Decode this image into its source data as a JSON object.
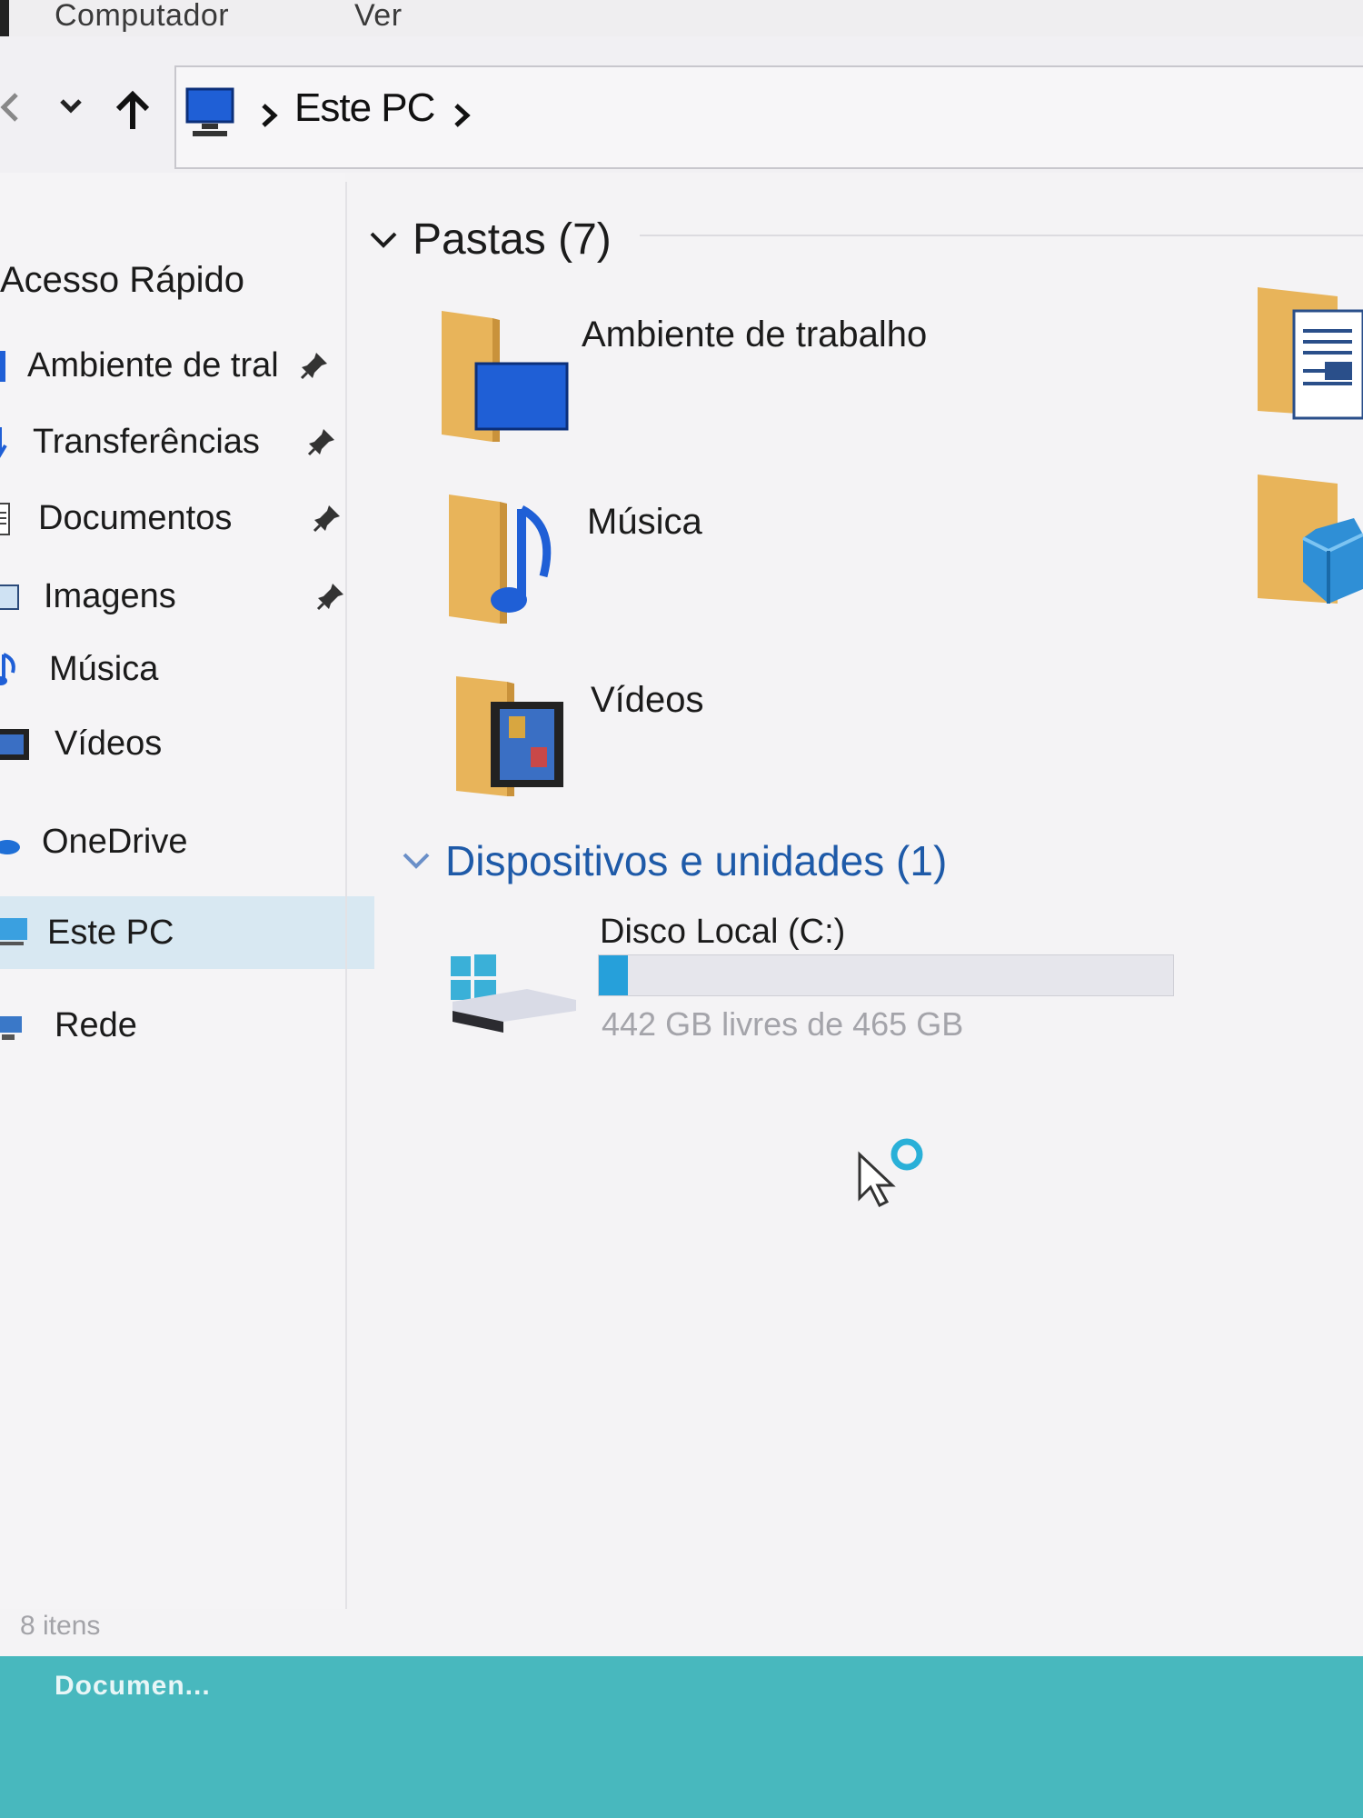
{
  "ribbon": {
    "tab_computer": "Computador",
    "tab_view": "Ver"
  },
  "address": {
    "breadcrumb_root": "Este PC",
    "icons": [
      "back-icon",
      "chevron-down-icon",
      "up-arrow-icon",
      "computer-icon",
      "chevron-right-icon"
    ]
  },
  "sidebar": {
    "quick_access": "Acesso Rápido",
    "items": [
      {
        "label": "Ambiente de tral",
        "icon": "desktop-icon",
        "pinned": true
      },
      {
        "label": "Transferências",
        "icon": "download-icon",
        "pinned": true
      },
      {
        "label": "Documentos",
        "icon": "documents-icon",
        "pinned": true
      },
      {
        "label": "Imagens",
        "icon": "pictures-icon",
        "pinned": true
      },
      {
        "label": "Música",
        "icon": "music-icon",
        "pinned": false
      },
      {
        "label": "Vídeos",
        "icon": "videos-icon",
        "pinned": false
      }
    ],
    "onedrive": "OneDrive",
    "this_pc": "Este PC",
    "network": "Rede"
  },
  "main": {
    "folders_header": "Pastas (7)",
    "folders": [
      {
        "label": "Ambiente de trabalho",
        "icon": "desktop-folder-icon"
      },
      {
        "label": "Música",
        "icon": "music-folder-icon"
      },
      {
        "label": "Vídeos",
        "icon": "videos-folder-icon"
      }
    ],
    "devices_header": "Dispositivos e unidades (1)",
    "drive": {
      "name": "Disco Local (C:)",
      "free_text": "442 GB livres de 465 GB",
      "used_fraction": 0.05,
      "accent": "#26a0da"
    }
  },
  "status_bar": {
    "items_count": "8 itens"
  },
  "taskbar": {
    "item_label": "Documen..."
  },
  "colors": {
    "taskbar": "#48b8be",
    "selection": "#d8e8f2",
    "folder": "#e8b45a",
    "link_blue": "#1e5aa8"
  }
}
